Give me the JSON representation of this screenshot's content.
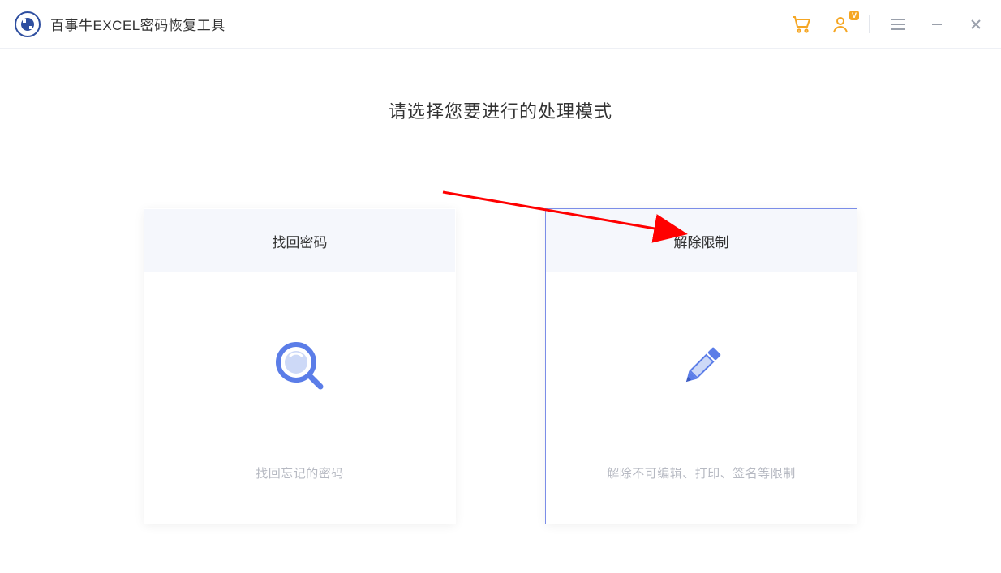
{
  "header": {
    "title": "百事牛EXCEL密码恢复工具",
    "vip_badge": "V"
  },
  "main": {
    "heading": "请选择您要进行的处理模式",
    "cards": [
      {
        "title": "找回密码",
        "description": "找回忘记的密码"
      },
      {
        "title": "解除限制",
        "description": "解除不可编辑、打印、签名等限制"
      }
    ]
  }
}
